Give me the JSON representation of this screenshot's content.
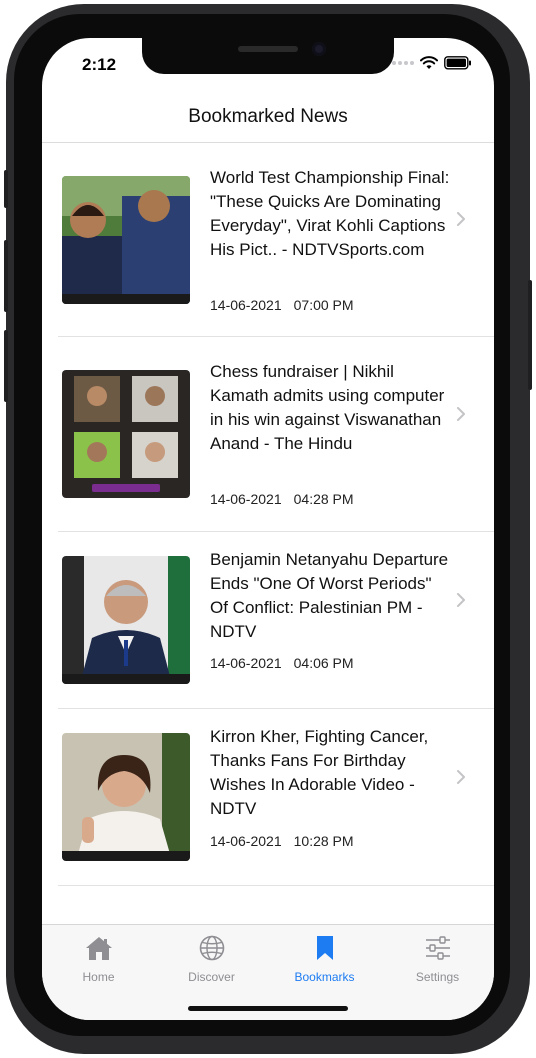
{
  "status_bar": {
    "time": "2:12"
  },
  "header": {
    "title": "Bookmarked News"
  },
  "articles": [
    {
      "title": "World Test Championship Final: \"These Quicks Are Dominating Everyday\", Virat Kohli Captions His Pict.. - NDTVSports.com",
      "date": "14-06-2021",
      "time": "07:00 PM"
    },
    {
      "title": "Chess fundraiser | Nikhil Kamath admits using computer in his win against Viswanathan Anand - The Hindu",
      "date": "14-06-2021",
      "time": "04:28 PM"
    },
    {
      "title": "Benjamin Netanyahu Departure Ends \"One Of Worst Periods\" Of Conflict: Palestinian PM - NDTV",
      "date": "14-06-2021",
      "time": "04:06 PM"
    },
    {
      "title": "Kirron Kher, Fighting Cancer, Thanks Fans For Birthday Wishes In Adorable Video - NDTV",
      "date": "14-06-2021",
      "time": "10:28 PM"
    }
  ],
  "tabs": [
    {
      "label": "Home",
      "icon": "home-icon",
      "active": false
    },
    {
      "label": "Discover",
      "icon": "globe-icon",
      "active": false
    },
    {
      "label": "Bookmarks",
      "icon": "bookmark-icon",
      "active": true
    },
    {
      "label": "Settings",
      "icon": "sliders-icon",
      "active": false
    }
  ],
  "colors": {
    "accent": "#1d7cf2",
    "inactive": "#8e8e93"
  }
}
